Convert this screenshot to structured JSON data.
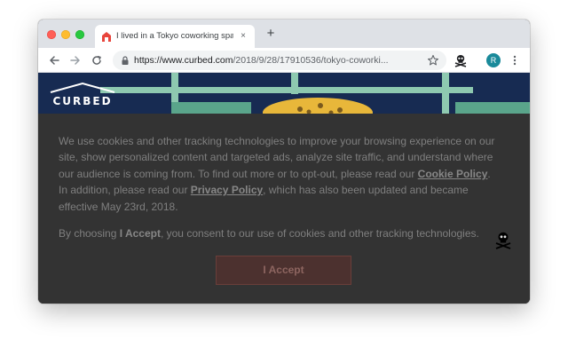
{
  "browser": {
    "tab": {
      "title": "I lived in a Tokyo coworking space",
      "close_glyph": "×"
    },
    "new_tab_glyph": "+",
    "address": {
      "scheme_host": "https://www.curbed.com",
      "path": "/2018/9/28/17910536/tokyo-coworki..."
    },
    "profile_initial": "R"
  },
  "site": {
    "logo_text": "CURBED"
  },
  "consent": {
    "p1_intro": "We use cookies and other tracking technologies to improve your browsing experience on our site, show personalized content and targeted ads, analyze site traffic, and understand where our audience is coming from. To find out more or to opt-out, please read our ",
    "cookie_policy_link": "Cookie Policy",
    "p1_middle": ". In addition, please read our ",
    "privacy_policy_link": "Privacy Policy",
    "p1_end": ", which has also been updated and became effective May 23rd, 2018.",
    "p2_start": "By choosing ",
    "p2_bold": "I Accept",
    "p2_end": ", you consent to our use of cookies and other tracking technologies.",
    "accept_label": "I Accept"
  },
  "colors": {
    "overlay": "#333333",
    "banner": "#172b52",
    "accept_button": "#4c312f",
    "avatar": "#1a8a9a"
  },
  "icons": [
    "curbed-favicon-icon",
    "back-arrow-icon",
    "forward-arrow-icon",
    "reload-icon",
    "lock-icon",
    "bookmark-star-icon",
    "skull-extension-icon",
    "kebab-menu-icon",
    "skull-icon"
  ]
}
